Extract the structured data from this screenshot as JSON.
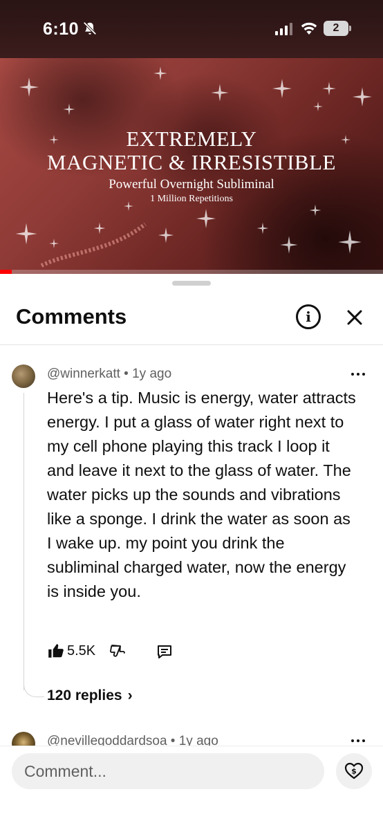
{
  "status_bar": {
    "time": "6:10",
    "battery_level": "2",
    "icons": [
      "bell-off-icon",
      "signal-icon",
      "wifi-icon",
      "battery-icon"
    ]
  },
  "video": {
    "title_line1": "EXTREMELY",
    "title_line2": "MAGNETIC & IRRESISTIBLE",
    "subtitle": "Powerful Overnight Subliminal",
    "subtitle2": "1 Million Repetitions",
    "progress_fraction": 0.03,
    "colors": {
      "progress": "#ff0000",
      "tint": "#8e3a36"
    }
  },
  "comments_panel": {
    "title": "Comments",
    "info_glyph": "i",
    "icons": [
      "info-icon",
      "close-icon"
    ]
  },
  "comments": [
    {
      "author": "@winnerkatt",
      "age": "1y ago",
      "text": "Here's a tip. Music is energy, water attracts energy. I put a glass of water right next to my cell phone playing this track I loop it and leave it next to the glass of water. The water picks up the sounds and vibrations like a sponge. I drink the water as soon as I wake up. my point you drink the subliminal charged water, now the energy is inside you.",
      "likes": "5.5K",
      "replies": "120 replies"
    },
    {
      "author": "@nevillegoddardsoa",
      "age": "1y ago"
    }
  ],
  "composer": {
    "placeholder": "Comment...",
    "icons": [
      "super-thanks-icon"
    ]
  },
  "separator": "•"
}
